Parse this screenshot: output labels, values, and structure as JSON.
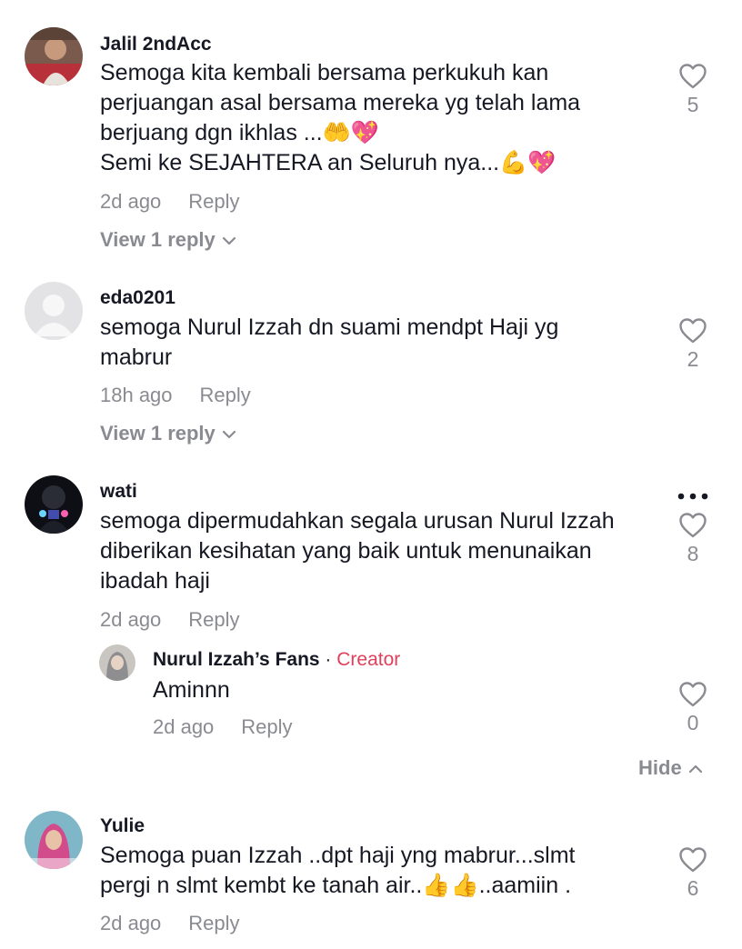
{
  "comments": [
    {
      "username": "Jalil 2ndAcc",
      "lines": [
        "Semoga kita kembali bersama perkukuh kan",
        "perjuangan asal bersama mereka yg telah lama",
        "berjuang dgn ikhlas ...🤲💖",
        "Semi ke SEJAHTERA an Seluruh nya...💪💖"
      ],
      "time": "2d ago",
      "reply_label": "Reply",
      "likes": "5",
      "view_replies": "View 1 reply"
    },
    {
      "username": "eda0201",
      "lines": [
        "semoga Nurul Izzah dn suami mendpt Haji yg",
        "mabrur"
      ],
      "time": "18h ago",
      "reply_label": "Reply",
      "likes": "2",
      "view_replies": "View 1 reply"
    },
    {
      "username": "wati",
      "lines": [
        "semoga dipermudahkan segala urusan Nurul Izzah",
        "diberikan kesihatan yang baik untuk menunaikan",
        "ibadah haji"
      ],
      "time": "2d ago",
      "reply_label": "Reply",
      "likes": "8",
      "more_label": "•••",
      "reply": {
        "username": "Nurul Izzah’s Fans",
        "separator": " · ",
        "badge": "Creator",
        "text": "Aminnn",
        "time": "2d ago",
        "reply_label": "Reply",
        "likes": "0"
      },
      "hide_label": "Hide"
    },
    {
      "username": "Yulie",
      "lines": [
        "Semoga puan Izzah ..dpt haji yng mabrur...slmt",
        "pergi n slmt kembt ke tanah air..👍👍..aamiin ."
      ],
      "time": "2d ago",
      "reply_label": "Reply",
      "likes": "6"
    }
  ],
  "icons": {
    "like": "heart-outline-icon",
    "expand": "chevron-down-icon",
    "collapse": "chevron-up-icon",
    "more": "more-horizontal-icon"
  },
  "colors": {
    "text": "#161823",
    "secondary": "#8a8b91",
    "creator_badge": "#e0405a"
  }
}
